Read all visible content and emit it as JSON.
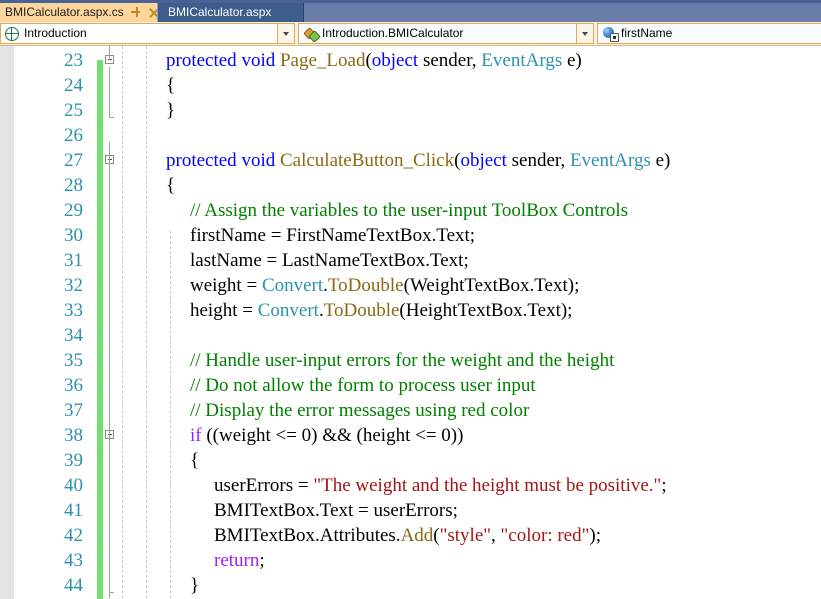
{
  "window": {
    "app": "Visual Studio Code Editor"
  },
  "tabs": [
    {
      "label": "BMICalculator.aspx.cs",
      "active": true,
      "pin_icon": "pin-icon",
      "close_icon": "close-icon"
    },
    {
      "label": "BMICalculator.aspx",
      "active": false
    }
  ],
  "navbar": {
    "project": {
      "label": "Introduction",
      "icon": "globe-icon"
    },
    "class": {
      "label": "Introduction.BMICalculator",
      "icon": "class-icon"
    },
    "member": {
      "label": "firstName",
      "icon": "private-field-icon"
    }
  },
  "editor": {
    "first_line_number": 23,
    "line_numbers": [
      23,
      24,
      25,
      26,
      27,
      28,
      29,
      30,
      31,
      32,
      33,
      34,
      35,
      36,
      37,
      38,
      39,
      40,
      41,
      42,
      43,
      44
    ],
    "colors": {
      "keyword": "#0000FF",
      "control_keyword": "#A020F0",
      "method": "#8B6914",
      "type": "#2B91AF",
      "string": "#A31515",
      "comment": "#008000",
      "plain": "#000000",
      "line_number": "#2B91AF",
      "change_bar": "#6FE06F",
      "margin": "#E4E4E6"
    },
    "lines": [
      {
        "n": 23,
        "indent": 0,
        "outline": "collapse",
        "tokens": [
          {
            "t": "protected ",
            "c": "k"
          },
          {
            "t": "void ",
            "c": "k"
          },
          {
            "t": "Page_Load",
            "c": "m"
          },
          {
            "t": "(",
            "c": "p"
          },
          {
            "t": "object",
            "c": "k"
          },
          {
            "t": " sender, ",
            "c": "p"
          },
          {
            "t": "EventArgs",
            "c": "t"
          },
          {
            "t": " e)",
            "c": "p"
          }
        ]
      },
      {
        "n": 24,
        "indent": 0,
        "tokens": [
          {
            "t": "{",
            "c": "p"
          }
        ]
      },
      {
        "n": 25,
        "indent": 0,
        "tokens": [
          {
            "t": "}",
            "c": "p"
          }
        ]
      },
      {
        "n": 26,
        "indent": 0,
        "tokens": []
      },
      {
        "n": 27,
        "indent": 0,
        "outline": "collapse",
        "tokens": [
          {
            "t": "protected ",
            "c": "k"
          },
          {
            "t": "void ",
            "c": "k"
          },
          {
            "t": "CalculateButton_Click",
            "c": "m"
          },
          {
            "t": "(",
            "c": "p"
          },
          {
            "t": "object",
            "c": "k"
          },
          {
            "t": " sender, ",
            "c": "p"
          },
          {
            "t": "EventArgs",
            "c": "t"
          },
          {
            "t": " e)",
            "c": "p"
          }
        ]
      },
      {
        "n": 28,
        "indent": 0,
        "tokens": [
          {
            "t": "{",
            "c": "p"
          }
        ]
      },
      {
        "n": 29,
        "indent": 1,
        "tokens": [
          {
            "t": "// Assign the variables to the user-input ToolBox Controls",
            "c": "c"
          }
        ]
      },
      {
        "n": 30,
        "indent": 1,
        "tokens": [
          {
            "t": "firstName = FirstNameTextBox.Text;",
            "c": "p"
          }
        ]
      },
      {
        "n": 31,
        "indent": 1,
        "tokens": [
          {
            "t": "lastName = LastNameTextBox.Text;",
            "c": "p"
          }
        ]
      },
      {
        "n": 32,
        "indent": 1,
        "tokens": [
          {
            "t": "weight = ",
            "c": "p"
          },
          {
            "t": "Convert",
            "c": "t"
          },
          {
            "t": ".",
            "c": "p"
          },
          {
            "t": "ToDouble",
            "c": "m"
          },
          {
            "t": "(WeightTextBox.Text);",
            "c": "p"
          }
        ]
      },
      {
        "n": 33,
        "indent": 1,
        "tokens": [
          {
            "t": "height = ",
            "c": "p"
          },
          {
            "t": "Convert",
            "c": "t"
          },
          {
            "t": ".",
            "c": "p"
          },
          {
            "t": "ToDouble",
            "c": "m"
          },
          {
            "t": "(HeightTextBox.Text);",
            "c": "p"
          }
        ]
      },
      {
        "n": 34,
        "indent": 1,
        "tokens": []
      },
      {
        "n": 35,
        "indent": 1,
        "tokens": [
          {
            "t": "// Handle user-input errors for the weight and the height",
            "c": "c"
          }
        ]
      },
      {
        "n": 36,
        "indent": 1,
        "tokens": [
          {
            "t": "// Do not allow the form to process user input",
            "c": "c"
          }
        ]
      },
      {
        "n": 37,
        "indent": 1,
        "tokens": [
          {
            "t": "// Display the error messages using red color",
            "c": "c"
          }
        ]
      },
      {
        "n": 38,
        "indent": 1,
        "outline": "collapse",
        "tokens": [
          {
            "t": "if",
            "c": "kc"
          },
          {
            "t": " ((weight <= 0) && (height <= 0))",
            "c": "p"
          }
        ]
      },
      {
        "n": 39,
        "indent": 1,
        "tokens": [
          {
            "t": "{",
            "c": "p"
          }
        ]
      },
      {
        "n": 40,
        "indent": 2,
        "tokens": [
          {
            "t": "userErrors = ",
            "c": "p"
          },
          {
            "t": "\"The weight and the height must be positive.\"",
            "c": "s"
          },
          {
            "t": ";",
            "c": "p"
          }
        ]
      },
      {
        "n": 41,
        "indent": 2,
        "tokens": [
          {
            "t": "BMITextBox.Text = userErrors;",
            "c": "p"
          }
        ]
      },
      {
        "n": 42,
        "indent": 2,
        "tokens": [
          {
            "t": "BMITextBox.Attributes.",
            "c": "p"
          },
          {
            "t": "Add",
            "c": "m"
          },
          {
            "t": "(",
            "c": "p"
          },
          {
            "t": "\"style\"",
            "c": "s"
          },
          {
            "t": ", ",
            "c": "p"
          },
          {
            "t": "\"color: red\"",
            "c": "s"
          },
          {
            "t": ");",
            "c": "p"
          }
        ]
      },
      {
        "n": 43,
        "indent": 2,
        "tokens": [
          {
            "t": "return",
            "c": "kc"
          },
          {
            "t": ";",
            "c": "p"
          }
        ]
      },
      {
        "n": 44,
        "indent": 1,
        "tokens": [
          {
            "t": "}",
            "c": "p"
          }
        ]
      }
    ]
  }
}
